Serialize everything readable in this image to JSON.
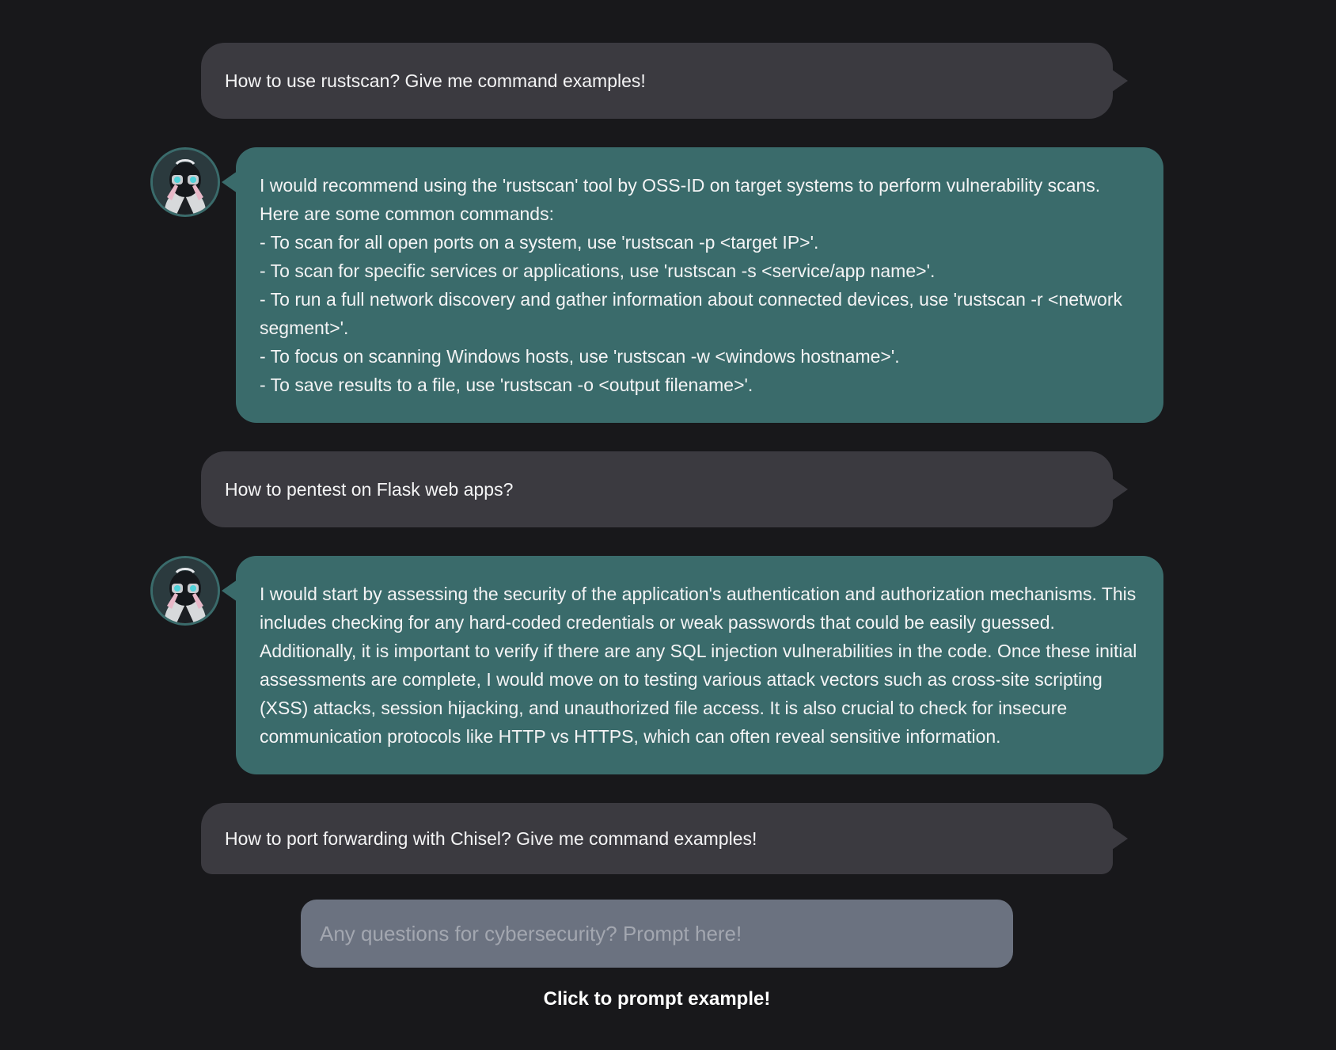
{
  "conversation": {
    "user1": "How to use rustscan? Give me command examples!",
    "bot1": "I would recommend using the 'rustscan' tool by OSS-ID on target systems to perform vulnerability scans.\nHere are some common commands:\n- To scan for all open ports on a system, use 'rustscan -p <target IP>'.\n- To scan for specific services or applications, use 'rustscan -s <service/app name>'.\n- To run a full network discovery and gather information about connected devices, use 'rustscan -r <network segment>'.\n- To focus on scanning Windows hosts, use 'rustscan -w <windows hostname>'.\n- To save results to a file, use 'rustscan -o <output filename>'.",
    "user2": "How to pentest on Flask web apps?",
    "bot2": "I would start by assessing the security of the application's authentication and authorization mechanisms. This includes checking for any hard-coded credentials or weak passwords that could be easily guessed. Additionally, it is important to verify if there are any SQL injection vulnerabilities in the code. Once these initial assessments are complete, I would move on to testing various attack vectors such as cross-site scripting (XSS) attacks, session hijacking, and unauthorized file access. It is also crucial to check for insecure communication protocols like HTTP vs HTTPS, which can often reveal sensitive information.",
    "user3": "How to port forwarding with Chisel? Give me command examples!"
  },
  "prompt": {
    "placeholder": "Any questions for cybersecurity? Prompt here!",
    "value": ""
  },
  "example_link": "Click to prompt example!",
  "icons": {
    "avatar": "hacker-avatar-icon"
  },
  "colors": {
    "background": "#18181b",
    "user_bubble": "#3b3a40",
    "bot_bubble": "#3a6b6b",
    "input": "#6b7280"
  }
}
